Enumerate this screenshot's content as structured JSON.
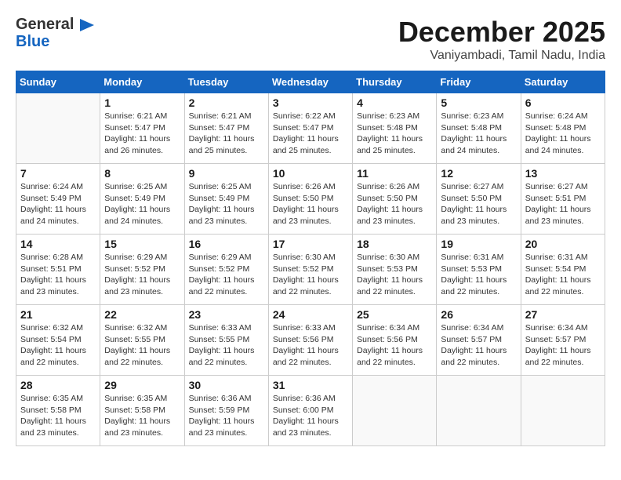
{
  "header": {
    "logo_line1": "General",
    "logo_line2": "Blue",
    "month": "December 2025",
    "location": "Vaniyambadi, Tamil Nadu, India"
  },
  "weekdays": [
    "Sunday",
    "Monday",
    "Tuesday",
    "Wednesday",
    "Thursday",
    "Friday",
    "Saturday"
  ],
  "weeks": [
    [
      {
        "day": "",
        "sunrise": "",
        "sunset": "",
        "daylight": ""
      },
      {
        "day": "1",
        "sunrise": "Sunrise: 6:21 AM",
        "sunset": "Sunset: 5:47 PM",
        "daylight": "Daylight: 11 hours and 26 minutes."
      },
      {
        "day": "2",
        "sunrise": "Sunrise: 6:21 AM",
        "sunset": "Sunset: 5:47 PM",
        "daylight": "Daylight: 11 hours and 25 minutes."
      },
      {
        "day": "3",
        "sunrise": "Sunrise: 6:22 AM",
        "sunset": "Sunset: 5:47 PM",
        "daylight": "Daylight: 11 hours and 25 minutes."
      },
      {
        "day": "4",
        "sunrise": "Sunrise: 6:23 AM",
        "sunset": "Sunset: 5:48 PM",
        "daylight": "Daylight: 11 hours and 25 minutes."
      },
      {
        "day": "5",
        "sunrise": "Sunrise: 6:23 AM",
        "sunset": "Sunset: 5:48 PM",
        "daylight": "Daylight: 11 hours and 24 minutes."
      },
      {
        "day": "6",
        "sunrise": "Sunrise: 6:24 AM",
        "sunset": "Sunset: 5:48 PM",
        "daylight": "Daylight: 11 hours and 24 minutes."
      }
    ],
    [
      {
        "day": "7",
        "sunrise": "Sunrise: 6:24 AM",
        "sunset": "Sunset: 5:49 PM",
        "daylight": "Daylight: 11 hours and 24 minutes."
      },
      {
        "day": "8",
        "sunrise": "Sunrise: 6:25 AM",
        "sunset": "Sunset: 5:49 PM",
        "daylight": "Daylight: 11 hours and 24 minutes."
      },
      {
        "day": "9",
        "sunrise": "Sunrise: 6:25 AM",
        "sunset": "Sunset: 5:49 PM",
        "daylight": "Daylight: 11 hours and 23 minutes."
      },
      {
        "day": "10",
        "sunrise": "Sunrise: 6:26 AM",
        "sunset": "Sunset: 5:50 PM",
        "daylight": "Daylight: 11 hours and 23 minutes."
      },
      {
        "day": "11",
        "sunrise": "Sunrise: 6:26 AM",
        "sunset": "Sunset: 5:50 PM",
        "daylight": "Daylight: 11 hours and 23 minutes."
      },
      {
        "day": "12",
        "sunrise": "Sunrise: 6:27 AM",
        "sunset": "Sunset: 5:50 PM",
        "daylight": "Daylight: 11 hours and 23 minutes."
      },
      {
        "day": "13",
        "sunrise": "Sunrise: 6:27 AM",
        "sunset": "Sunset: 5:51 PM",
        "daylight": "Daylight: 11 hours and 23 minutes."
      }
    ],
    [
      {
        "day": "14",
        "sunrise": "Sunrise: 6:28 AM",
        "sunset": "Sunset: 5:51 PM",
        "daylight": "Daylight: 11 hours and 23 minutes."
      },
      {
        "day": "15",
        "sunrise": "Sunrise: 6:29 AM",
        "sunset": "Sunset: 5:52 PM",
        "daylight": "Daylight: 11 hours and 23 minutes."
      },
      {
        "day": "16",
        "sunrise": "Sunrise: 6:29 AM",
        "sunset": "Sunset: 5:52 PM",
        "daylight": "Daylight: 11 hours and 22 minutes."
      },
      {
        "day": "17",
        "sunrise": "Sunrise: 6:30 AM",
        "sunset": "Sunset: 5:52 PM",
        "daylight": "Daylight: 11 hours and 22 minutes."
      },
      {
        "day": "18",
        "sunrise": "Sunrise: 6:30 AM",
        "sunset": "Sunset: 5:53 PM",
        "daylight": "Daylight: 11 hours and 22 minutes."
      },
      {
        "day": "19",
        "sunrise": "Sunrise: 6:31 AM",
        "sunset": "Sunset: 5:53 PM",
        "daylight": "Daylight: 11 hours and 22 minutes."
      },
      {
        "day": "20",
        "sunrise": "Sunrise: 6:31 AM",
        "sunset": "Sunset: 5:54 PM",
        "daylight": "Daylight: 11 hours and 22 minutes."
      }
    ],
    [
      {
        "day": "21",
        "sunrise": "Sunrise: 6:32 AM",
        "sunset": "Sunset: 5:54 PM",
        "daylight": "Daylight: 11 hours and 22 minutes."
      },
      {
        "day": "22",
        "sunrise": "Sunrise: 6:32 AM",
        "sunset": "Sunset: 5:55 PM",
        "daylight": "Daylight: 11 hours and 22 minutes."
      },
      {
        "day": "23",
        "sunrise": "Sunrise: 6:33 AM",
        "sunset": "Sunset: 5:55 PM",
        "daylight": "Daylight: 11 hours and 22 minutes."
      },
      {
        "day": "24",
        "sunrise": "Sunrise: 6:33 AM",
        "sunset": "Sunset: 5:56 PM",
        "daylight": "Daylight: 11 hours and 22 minutes."
      },
      {
        "day": "25",
        "sunrise": "Sunrise: 6:34 AM",
        "sunset": "Sunset: 5:56 PM",
        "daylight": "Daylight: 11 hours and 22 minutes."
      },
      {
        "day": "26",
        "sunrise": "Sunrise: 6:34 AM",
        "sunset": "Sunset: 5:57 PM",
        "daylight": "Daylight: 11 hours and 22 minutes."
      },
      {
        "day": "27",
        "sunrise": "Sunrise: 6:34 AM",
        "sunset": "Sunset: 5:57 PM",
        "daylight": "Daylight: 11 hours and 22 minutes."
      }
    ],
    [
      {
        "day": "28",
        "sunrise": "Sunrise: 6:35 AM",
        "sunset": "Sunset: 5:58 PM",
        "daylight": "Daylight: 11 hours and 23 minutes."
      },
      {
        "day": "29",
        "sunrise": "Sunrise: 6:35 AM",
        "sunset": "Sunset: 5:58 PM",
        "daylight": "Daylight: 11 hours and 23 minutes."
      },
      {
        "day": "30",
        "sunrise": "Sunrise: 6:36 AM",
        "sunset": "Sunset: 5:59 PM",
        "daylight": "Daylight: 11 hours and 23 minutes."
      },
      {
        "day": "31",
        "sunrise": "Sunrise: 6:36 AM",
        "sunset": "Sunset: 6:00 PM",
        "daylight": "Daylight: 11 hours and 23 minutes."
      },
      {
        "day": "",
        "sunrise": "",
        "sunset": "",
        "daylight": ""
      },
      {
        "day": "",
        "sunrise": "",
        "sunset": "",
        "daylight": ""
      },
      {
        "day": "",
        "sunrise": "",
        "sunset": "",
        "daylight": ""
      }
    ]
  ]
}
